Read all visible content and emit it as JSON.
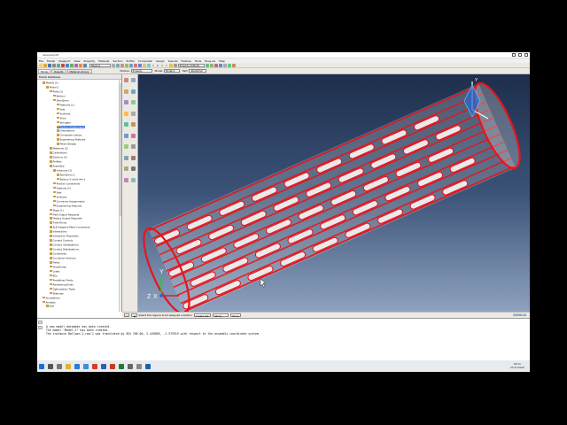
{
  "window": {
    "title": "Abaqus/CAE"
  },
  "menu": [
    "File",
    "Model",
    "Viewport",
    "View",
    "Property",
    "Material",
    "Section",
    "Profile",
    "Composite",
    "Assign",
    "Special",
    "Feature",
    "Tools",
    "Plug-ins",
    "Help"
  ],
  "toolbar": {
    "module_combo": "Regions",
    "numbers": [
      "1",
      "2",
      "3",
      "4"
    ],
    "color_combo": "Property defaults"
  },
  "context": {
    "module_label": "Module:",
    "module_value": "Property",
    "model_label": "Model:",
    "model_value": "Model-1",
    "part_label": "Part:",
    "part_value": "Stent2mm"
  },
  "tree_tabs": [
    "Model",
    "Results",
    "Material Library"
  ],
  "tree": {
    "header": "Model Database",
    "nodes": [
      {
        "label": "Models (1)",
        "indent": 1
      },
      {
        "label": "Model-1",
        "indent": 2
      },
      {
        "label": "Parts (2)",
        "indent": 3
      },
      {
        "label": "Balloon",
        "indent": 4
      },
      {
        "label": "Stent2mm",
        "indent": 4
      },
      {
        "label": "Features (1)",
        "indent": 5
      },
      {
        "label": "Sets",
        "indent": 5
      },
      {
        "label": "Surfaces",
        "indent": 5
      },
      {
        "label": "Skins",
        "indent": 5
      },
      {
        "label": "Stringers",
        "indent": 5
      },
      {
        "label": "Section Assignments",
        "indent": 5,
        "selected": true
      },
      {
        "label": "Orientations",
        "indent": 5
      },
      {
        "label": "Composite Layups",
        "indent": 5
      },
      {
        "label": "Engineering Features",
        "indent": 5
      },
      {
        "label": "Mesh (Empty)",
        "indent": 5
      },
      {
        "label": "Materials (2)",
        "indent": 3
      },
      {
        "label": "Calibrations",
        "indent": 3
      },
      {
        "label": "Sections (2)",
        "indent": 3
      },
      {
        "label": "Profiles",
        "indent": 3
      },
      {
        "label": "Assembly",
        "indent": 3
      },
      {
        "label": "Instances (2)",
        "indent": 4
      },
      {
        "label": "Stent2mm-1",
        "indent": 5
      },
      {
        "label": "Balloon-1-rad-0.4m-1",
        "indent": 5
      },
      {
        "label": "Position Constraints",
        "indent": 4
      },
      {
        "label": "Features (2)",
        "indent": 4
      },
      {
        "label": "Sets",
        "indent": 4
      },
      {
        "label": "Surfaces",
        "indent": 4
      },
      {
        "label": "Connector Assignments",
        "indent": 4
      },
      {
        "label": "Engineering Features",
        "indent": 4
      },
      {
        "label": "Steps (1)",
        "indent": 3
      },
      {
        "label": "Field Output Requests",
        "indent": 3
      },
      {
        "label": "History Output Requests",
        "indent": 3
      },
      {
        "label": "Time Points",
        "indent": 3
      },
      {
        "label": "ALE Adaptive Mesh Constraints",
        "indent": 3
      },
      {
        "label": "Interactions",
        "indent": 3
      },
      {
        "label": "Interaction Properties",
        "indent": 3
      },
      {
        "label": "Contact Controls",
        "indent": 3
      },
      {
        "label": "Contact Initializations",
        "indent": 3
      },
      {
        "label": "Contact Stabilizations",
        "indent": 3
      },
      {
        "label": "Constraints",
        "indent": 3
      },
      {
        "label": "Connector Sections",
        "indent": 3
      },
      {
        "label": "Fields",
        "indent": 3
      },
      {
        "label": "Amplitudes",
        "indent": 3
      },
      {
        "label": "Loads",
        "indent": 3
      },
      {
        "label": "BCs",
        "indent": 3
      },
      {
        "label": "Predefined Fields",
        "indent": 3
      },
      {
        "label": "Remeshing Rules",
        "indent": 3
      },
      {
        "label": "Optimization Tasks",
        "indent": 3
      },
      {
        "label": "Sketches",
        "indent": 3
      },
      {
        "label": "Annotations",
        "indent": 1
      },
      {
        "label": "Analysis",
        "indent": 1
      },
      {
        "label": "Jobs",
        "indent": 2
      }
    ]
  },
  "prompt": {
    "text": "Select the regions to be assigned a section",
    "create_set": "Create set:",
    "set_name": "Stent-Body",
    "done": "Done"
  },
  "brand": "SIMULIA",
  "triad": {
    "x": "X",
    "y": "Y",
    "z": "Z"
  },
  "messages": [
    "A new model database has been created.",
    "The model \"Model-1\" has been created.",
    "The instance Balloon-1-rad-1 was translated by 5E4 70E-06, 2.44985E, -1.375919 with respect to the assembly coordinate system"
  ],
  "clock": {
    "time": "09:11",
    "date": "27/11/2020"
  },
  "colors": {
    "part_edges": "#e8141c",
    "part_fill": "#d8d8d8",
    "viewport_top": "#1e2e4c",
    "viewport_bottom": "#8fa2bf",
    "selection": "#3a78d6"
  }
}
